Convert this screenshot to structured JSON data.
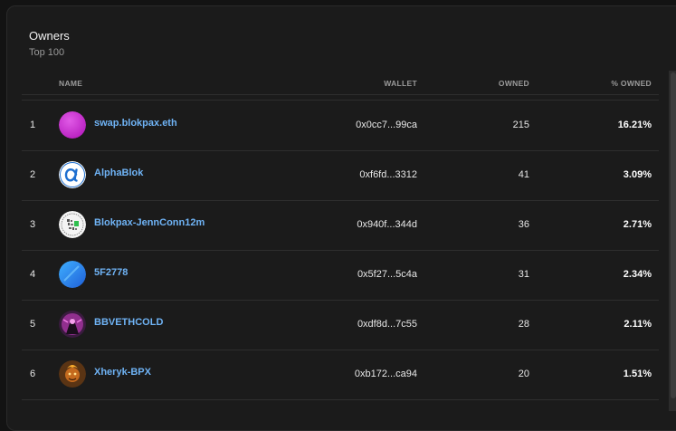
{
  "panel": {
    "title": "Owners",
    "subtitle": "Top 100"
  },
  "columns": {
    "name": "NAME",
    "wallet": "WALLET",
    "owned": "OWNED",
    "pct": "% OWNED"
  },
  "rows": [
    {
      "rank": "1",
      "name": "swap.blokpax.eth",
      "wallet": "0x0cc7...99ca",
      "owned": "215",
      "pct": "16.21%",
      "avatar": "magenta-circle"
    },
    {
      "rank": "2",
      "name": "AlphaBlok",
      "wallet": "0xf6fd...3312",
      "owned": "41",
      "pct": "3.09%",
      "avatar": "alpha-logo"
    },
    {
      "rank": "3",
      "name": "Blokpax-JennConn12m",
      "wallet": "0x940f...344d",
      "owned": "36",
      "pct": "2.71%",
      "avatar": "qr-avatar"
    },
    {
      "rank": "4",
      "name": "5F2778",
      "wallet": "0x5f27...5c4a",
      "owned": "31",
      "pct": "2.34%",
      "avatar": "blue-gradient"
    },
    {
      "rank": "5",
      "name": "BBVETHCOLD",
      "wallet": "0xdf8d...7c55",
      "owned": "28",
      "pct": "2.11%",
      "avatar": "pink-character"
    },
    {
      "rank": "6",
      "name": "Xheryk-BPX",
      "wallet": "0xb172...ca94",
      "owned": "20",
      "pct": "1.51%",
      "avatar": "fire-character"
    }
  ],
  "colors": {
    "link": "#6fb3f5",
    "background": "#1b1b1b"
  }
}
